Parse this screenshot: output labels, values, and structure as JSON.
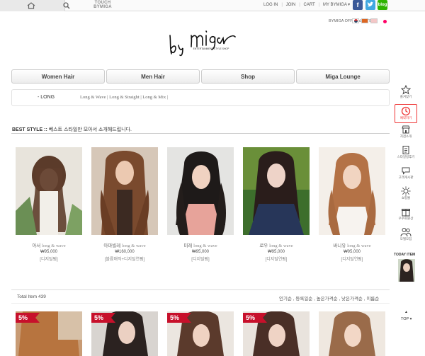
{
  "topbar": {
    "touch_line1": "TOUCH",
    "touch_line2": "BYMIGA",
    "links": [
      "LOG IN",
      "JOIN",
      "CART",
      "MY BYMIGA ▾"
    ],
    "blog_label": "blog"
  },
  "official_site": "BYMIGA OFFICIAL SITE",
  "logo": {
    "main": "by miga",
    "sub": "ENTERTAINMENT STYLE SHOP"
  },
  "nav": [
    "Women Hair",
    "Men Hair",
    "Shop",
    "Miga Lounge"
  ],
  "subcat": {
    "current": "- LONG",
    "links": "Long & Wave | Long & Straight | Long & Mix |"
  },
  "best": {
    "label": "BEST STYLE ::",
    "desc": "베스트 스타일만 모아서 소개해드립니다."
  },
  "products": [
    {
      "name_ko": "아서",
      "name_en": "long & wave",
      "price": "₩95,000",
      "tag": "[디지털펌]"
    },
    {
      "name_ko": "아마빌레",
      "name_en": "long & wave",
      "price": "₩160,000",
      "tag": "[볼륨매직+디지털연펌]"
    },
    {
      "name_ko": "미래",
      "name_en": "long & wave",
      "price": "₩95,000",
      "tag": "[디지털펌]"
    },
    {
      "name_ko": "로우",
      "name_en": "long & wave",
      "price": "₩95,000",
      "tag": "[디지털연펌]"
    },
    {
      "name_ko": "바니유",
      "name_en": "long & wave",
      "price": "₩95,000",
      "tag": "[디지털연펌]"
    }
  ],
  "listing": {
    "total": "Total Item 439",
    "sorts": "인기순 , 등록일순 , 높은가격순 , 낮은가격순 , 이름순"
  },
  "discount_badge": "5%",
  "quick_menu": [
    "즐겨찾기",
    "예약하기",
    "지점소개",
    "스타일링후기",
    "고객게시판",
    "쇼핑몰",
    "우수회원상",
    "모델모집"
  ],
  "today_item": "TODAY ITEM",
  "top_label": "TOP",
  "colors": {
    "accent_red": "#c7102b",
    "facebook": "#3b5998",
    "twitter": "#41a8e0",
    "blog": "#2db400"
  }
}
